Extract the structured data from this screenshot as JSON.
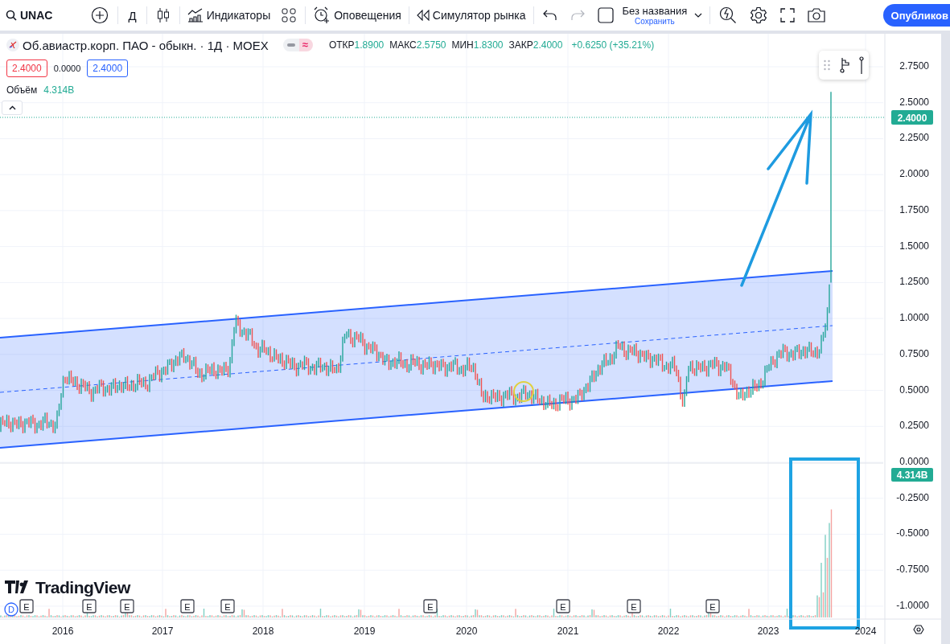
{
  "toolbar": {
    "symbol": "UNAC",
    "interval": "Д",
    "indicators": "Индикаторы",
    "alerts": "Оповещения",
    "replay": "Симулятор рынка",
    "redo_disabled": true,
    "layout_name": "Без названия",
    "save": "Сохранить",
    "publish": "Опубликов"
  },
  "legend": {
    "title": "Об.авиастр.корп. ПАО - обыкн. · 1Д · MOEX",
    "mode": "≈",
    "ohlc": [
      {
        "label": "ОТКР",
        "value": "1.8900"
      },
      {
        "label": "МАКС",
        "value": "2.5750"
      },
      {
        "label": "МИН",
        "value": "1.8300"
      },
      {
        "label": "ЗАКР",
        "value": "2.4000"
      }
    ],
    "change": "+0.6250 (+35.21%)",
    "bid": "2.4000",
    "spread": "0.0000",
    "ask": "2.4000"
  },
  "volume": {
    "label": "Объём",
    "value": "4.314B"
  },
  "price_axis": {
    "ticks": [
      "2.7500",
      "2.5000",
      "2.2500",
      "2.0000",
      "1.7500",
      "1.5000",
      "1.2500",
      "1.0000",
      "0.7500",
      "0.5000",
      "0.2500",
      "0.0000",
      "-0.2500",
      "-0.5000",
      "-0.7500",
      "-1.0000"
    ],
    "last_price": "2.4000",
    "volume_tag": "4.314B"
  },
  "time_axis": {
    "labels": [
      "2016",
      "2017",
      "2018",
      "2019",
      "2020",
      "2021",
      "2022",
      "2023",
      "2024"
    ]
  },
  "events": [
    {
      "kind": "dividend",
      "label": "D"
    },
    {
      "kind": "earnings",
      "label": "E"
    },
    {
      "kind": "earnings",
      "label": "E"
    },
    {
      "kind": "earnings",
      "label": "E"
    },
    {
      "kind": "earnings",
      "label": "E"
    },
    {
      "kind": "earnings",
      "label": "E"
    },
    {
      "kind": "earnings",
      "label": "E"
    },
    {
      "kind": "earnings",
      "label": "E"
    },
    {
      "kind": "earnings",
      "label": "E"
    },
    {
      "kind": "earnings",
      "label": "E"
    }
  ],
  "logo": "TradingView"
}
